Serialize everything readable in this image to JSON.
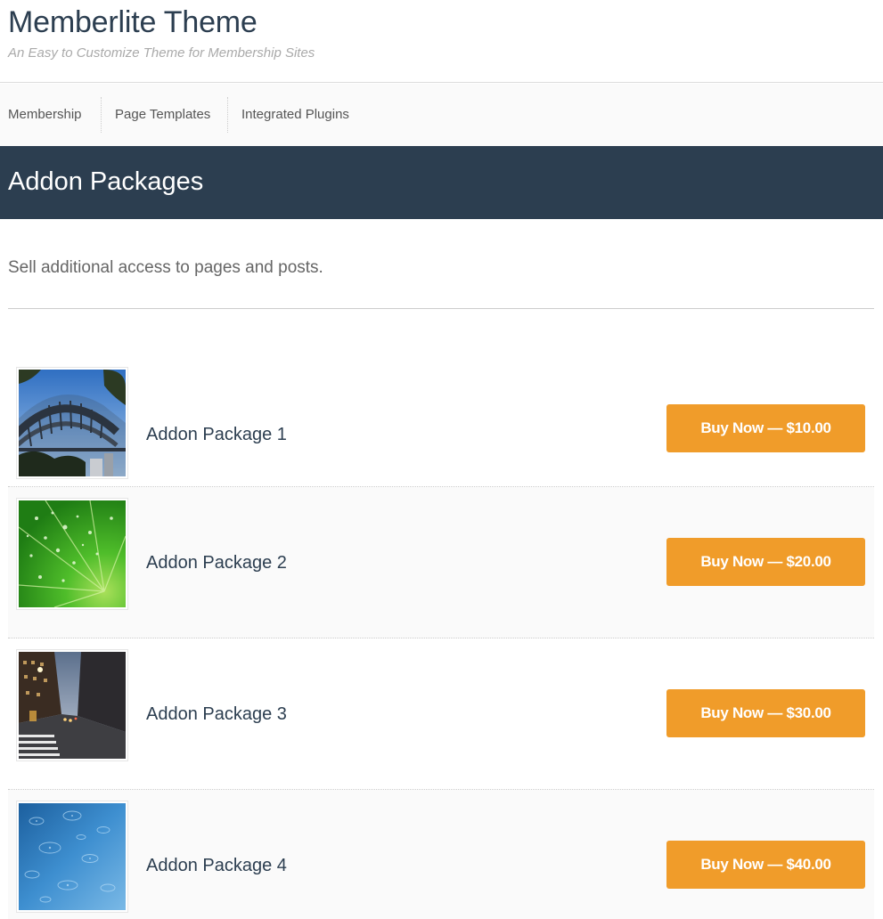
{
  "header": {
    "title": "Memberlite Theme",
    "description": "An Easy to Customize Theme for Membership Sites"
  },
  "nav": {
    "items": [
      {
        "label": "Membership"
      },
      {
        "label": "Page Templates"
      },
      {
        "label": "Integrated Plugins"
      }
    ]
  },
  "page": {
    "title": "Addon Packages",
    "intro": "Sell additional access to pages and posts."
  },
  "packages": [
    {
      "name": "Addon Package 1",
      "button": "Buy Now — $10.00",
      "image": "bridge-photo"
    },
    {
      "name": "Addon Package 2",
      "button": "Buy Now — $20.00",
      "image": "leaf-photo"
    },
    {
      "name": "Addon Package 3",
      "button": "Buy Now — $30.00",
      "image": "city-street-photo"
    },
    {
      "name": "Addon Package 4",
      "button": "Buy Now — $40.00",
      "image": "water-photo"
    }
  ],
  "colors": {
    "masthead": "#2c3e50",
    "button": "#f09c2a",
    "text": "#2c3e50"
  }
}
